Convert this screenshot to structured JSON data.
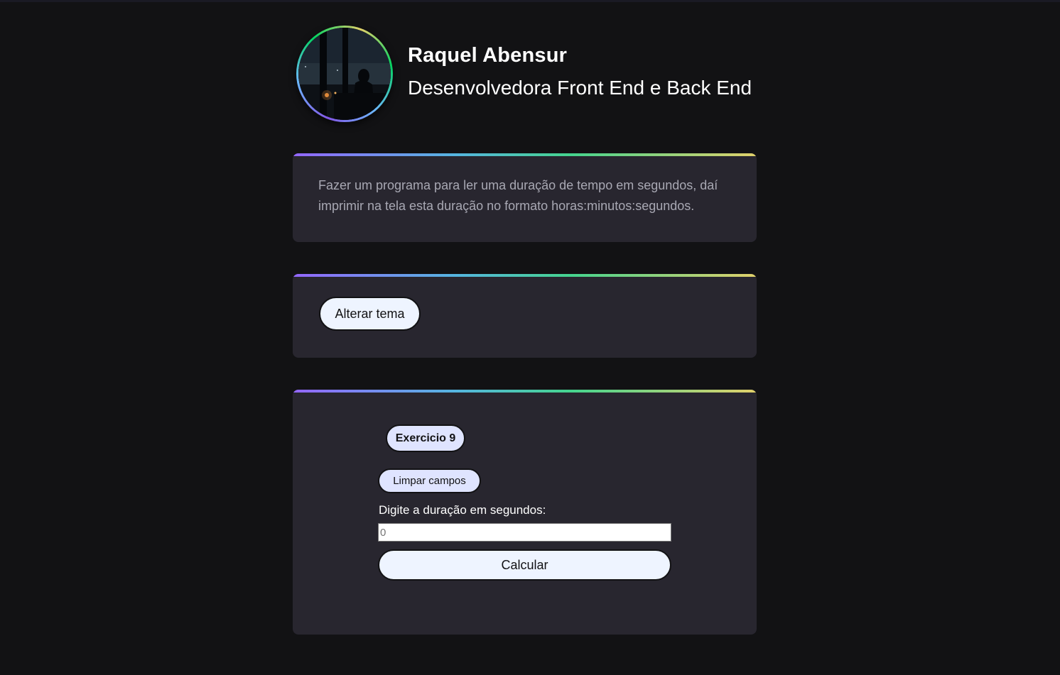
{
  "profile": {
    "name": "Raquel Abensur",
    "role": "Desenvolvedora Front End e Back End",
    "avatar_icon": "profile-photo"
  },
  "description": {
    "text": "Fazer um programa para ler uma duração de tempo em segundos, daí imprimir na tela esta duração no formato horas:minutos:segundos."
  },
  "theme": {
    "toggle_label": "Alterar tema"
  },
  "exercise": {
    "title": "Exercicio 9",
    "clear_label": "Limpar campos",
    "input_label": "Digite a duração em segundos:",
    "input_placeholder": "0",
    "input_value": "",
    "submit_label": "Calcular"
  },
  "colors": {
    "background": "#121214",
    "card": "#28262f",
    "gradient": [
      "#9466ff",
      "#55b5e0",
      "#45d48e",
      "#e1d16b"
    ],
    "button": "#eef4ff",
    "badge": "#dfe4ff"
  }
}
